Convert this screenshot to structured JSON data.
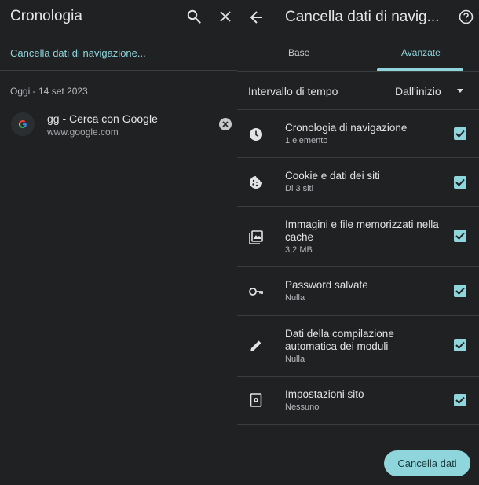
{
  "left": {
    "title": "Cronologia",
    "clear_link": "Cancella dati di navigazione...",
    "date_header": "Oggi - 14 set 2023",
    "entry": {
      "title": "gg - Cerca con Google",
      "url": "www.google.com"
    }
  },
  "right": {
    "title": "Cancella dati di navigazione",
    "tabs": [
      "Base",
      "Avanzate"
    ],
    "active_tab": "Avanzate",
    "time_range": {
      "label": "Intervallo di tempo",
      "value": "Dall'inizio"
    },
    "options": [
      {
        "icon": "clock-icon",
        "title": "Cronologia di navigazione",
        "subtitle": "1 elemento",
        "checked": true
      },
      {
        "icon": "cookie-icon",
        "title": "Cookie e dati dei siti",
        "subtitle": "Di 3 siti",
        "checked": true
      },
      {
        "icon": "images-icon",
        "title": "Immagini e file memorizzati nella cache",
        "subtitle": "3,2 MB",
        "checked": true
      },
      {
        "icon": "key-icon",
        "title": "Password salvate",
        "subtitle": "Nulla",
        "checked": true
      },
      {
        "icon": "pencil-icon",
        "title": "Dati della compilazione automatica dei moduli",
        "subtitle": "Nulla",
        "checked": true
      },
      {
        "icon": "site-settings-icon",
        "title": "Impostazioni sito",
        "subtitle": "Nessuno",
        "checked": true
      }
    ],
    "clear_button": "Cancella dati"
  },
  "colors": {
    "accent": "#8ed6dc",
    "background": "#1f2123",
    "divider": "#3a3d40"
  }
}
